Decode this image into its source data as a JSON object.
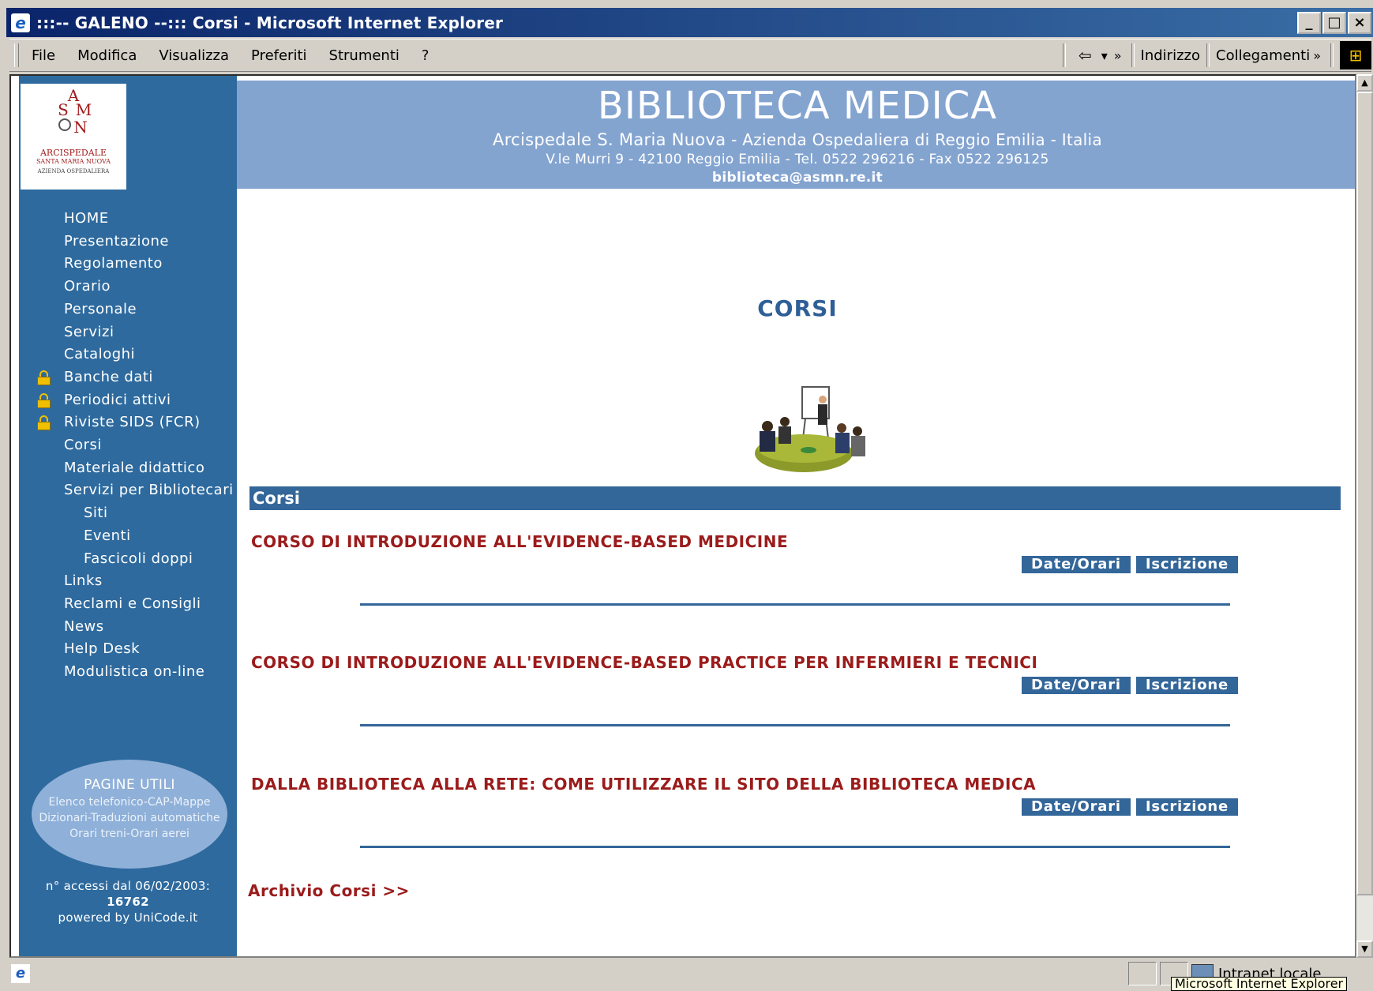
{
  "window": {
    "title": ":::-- GALENO --::: Corsi - Microsoft Internet Explorer",
    "min": "_",
    "max": "□",
    "close": "×"
  },
  "menu": {
    "items": [
      "File",
      "Modifica",
      "Visualizza",
      "Preferiti",
      "Strumenti",
      "?"
    ],
    "back_glyph": "⇦",
    "dropdown_glyph": "▾",
    "more_glyph": "»",
    "address_label": "Indirizzo",
    "links_label": "Collegamenti"
  },
  "logo": {
    "monogram": "ASMN",
    "line1": "ARCISPEDALE",
    "line2": "SANTA MARIA NUOVA",
    "line3": "AZIENDA OSPEDALIERA"
  },
  "header": {
    "title": "BIBLIOTECA MEDICA",
    "sub1_a": "Arcispedale S. Maria Nuova",
    "sub1_b": " - Azienda Ospedaliera di Reggio Emilia - Italia",
    "sub2": "V.le Murri 9 - 42100 Reggio Emilia - Tel. 0522 296216 - Fax 0522 296125",
    "email": "biblioteca@asmn.re.it"
  },
  "nav": [
    {
      "label": "HOME",
      "lock": false,
      "indent": 0
    },
    {
      "label": "Presentazione",
      "lock": false,
      "indent": 0
    },
    {
      "label": "Regolamento",
      "lock": false,
      "indent": 0
    },
    {
      "label": "Orario",
      "lock": false,
      "indent": 0
    },
    {
      "label": "Personale",
      "lock": false,
      "indent": 0
    },
    {
      "label": "Servizi",
      "lock": false,
      "indent": 0
    },
    {
      "label": "Cataloghi",
      "lock": false,
      "indent": 0
    },
    {
      "label": "Banche dati",
      "lock": true,
      "indent": 0
    },
    {
      "label": "Periodici attivi",
      "lock": true,
      "indent": 0
    },
    {
      "label": "Riviste SIDS (FCR)",
      "lock": true,
      "indent": 0
    },
    {
      "label": "Corsi",
      "lock": false,
      "indent": 0
    },
    {
      "label": "Materiale didattico",
      "lock": false,
      "indent": 0
    },
    {
      "label": "Servizi per Bibliotecari",
      "lock": false,
      "indent": 0
    },
    {
      "label": "Siti",
      "lock": false,
      "indent": 1
    },
    {
      "label": "Eventi",
      "lock": false,
      "indent": 1
    },
    {
      "label": "Fascicoli doppi",
      "lock": false,
      "indent": 1
    },
    {
      "label": "Links",
      "lock": false,
      "indent": 0
    },
    {
      "label": "Reclami e Consigli",
      "lock": false,
      "indent": 0
    },
    {
      "label": "News",
      "lock": false,
      "indent": 0
    },
    {
      "label": "Help Desk",
      "lock": false,
      "indent": 0
    },
    {
      "label": "Modulistica on-line",
      "lock": false,
      "indent": 0
    }
  ],
  "pagine_utili": {
    "title": "PAGINE UTILI",
    "lines": [
      "Elenco telefonico-CAP-Mappe",
      "Dizionari-Traduzioni automatiche",
      "Orari treni-Orari aerei"
    ]
  },
  "counter": {
    "label": "n° accessi dal 06/02/2003:",
    "value": "16762",
    "powered": "powered by UniCode.it"
  },
  "main": {
    "title": "CORSI",
    "section": "Corsi",
    "courses": [
      {
        "title": "CORSO DI INTRODUZIONE ALL'EVIDENCE-BASED MEDICINE",
        "btn_date": "Date/Orari",
        "btn_sub": "Iscrizione"
      },
      {
        "title": "CORSO DI INTRODUZIONE ALL'EVIDENCE-BASED PRACTICE PER INFERMIERI E TECNICI",
        "btn_date": "Date/Orari",
        "btn_sub": "Iscrizione"
      },
      {
        "title": "DALLA BIBLIOTECA ALLA RETE: COME UTILIZZARE IL SITO DELLA BIBLIOTECA MEDICA",
        "btn_date": "Date/Orari",
        "btn_sub": "Iscrizione"
      }
    ],
    "archive": "Archivio Corsi >>"
  },
  "status": {
    "zone": "Intranet locale",
    "tooltip": "Microsoft Internet Explorer"
  },
  "colors": {
    "sidebar": "#2e6a9e",
    "header": "#84a4d0",
    "accent": "#336699",
    "course_title": "#9b1b1b"
  }
}
